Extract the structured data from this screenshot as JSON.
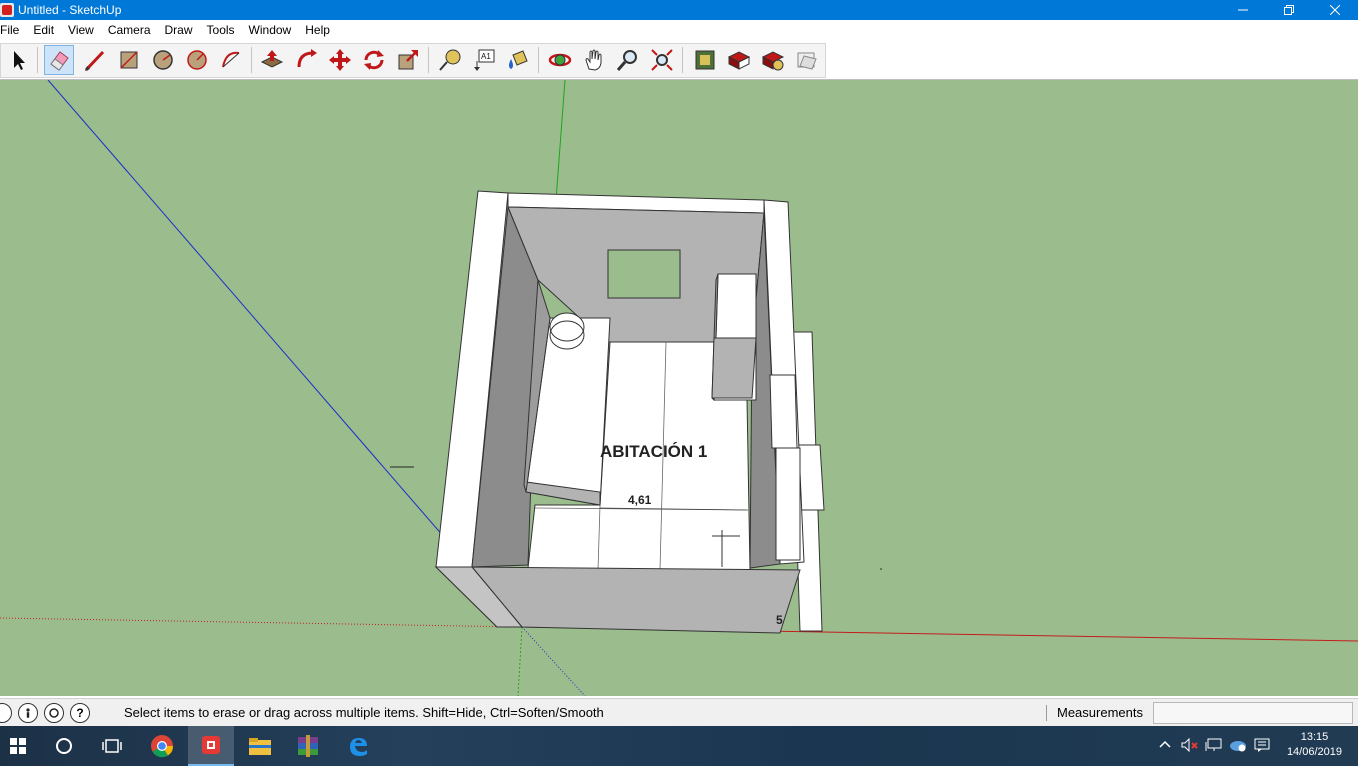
{
  "window": {
    "title": "Untitled - SketchUp",
    "controls": [
      "minimize-icon",
      "restore-icon",
      "close-icon"
    ]
  },
  "menu": [
    "File",
    "Edit",
    "View",
    "Camera",
    "Draw",
    "Tools",
    "Window",
    "Help"
  ],
  "toolbar": {
    "tools": [
      {
        "name": "select-tool",
        "icon": "arrow-cursor-icon"
      },
      {
        "name": "eraser-tool",
        "icon": "eraser-icon",
        "active": true
      },
      {
        "name": "line-tool",
        "icon": "pencil-icon"
      },
      {
        "name": "rectangle-tool",
        "icon": "rectangle-icon"
      },
      {
        "name": "circle-tool",
        "icon": "circle-icon"
      },
      {
        "name": "polygon-tool",
        "icon": "polygon-icon"
      },
      {
        "name": "arc-tool",
        "icon": "arc-icon"
      },
      {
        "name": "push-pull-tool",
        "icon": "push-pull-icon"
      },
      {
        "name": "follow-me-tool",
        "icon": "follow-me-icon"
      },
      {
        "name": "move-tool",
        "icon": "move-arrows-icon"
      },
      {
        "name": "rotate-tool",
        "icon": "rotate-icon"
      },
      {
        "name": "scale-tool",
        "icon": "scale-icon"
      },
      {
        "name": "tape-measure-tool",
        "icon": "tape-measure-icon"
      },
      {
        "name": "text-tool",
        "icon": "text-label-icon"
      },
      {
        "name": "paint-bucket-tool",
        "icon": "paint-bucket-icon"
      },
      {
        "name": "orbit-tool",
        "icon": "orbit-icon"
      },
      {
        "name": "pan-tool",
        "icon": "hand-icon"
      },
      {
        "name": "zoom-tool",
        "icon": "magnifier-icon"
      },
      {
        "name": "zoom-extents-tool",
        "icon": "zoom-extents-icon"
      },
      {
        "name": "3d-warehouse-tool",
        "icon": "warehouse-icon"
      },
      {
        "name": "extension-warehouse-tool",
        "icon": "extension-warehouse-icon"
      },
      {
        "name": "extension-manager-tool",
        "icon": "extension-manager-icon"
      },
      {
        "name": "layout-tool",
        "icon": "layout-icon"
      }
    ],
    "text_tool_label": "A1"
  },
  "viewport": {
    "colors": {
      "background": "#9bbd8e",
      "axis_green": "#1fa51f",
      "axis_blue": "#1b2ec4",
      "axis_red": "#c41b1b"
    },
    "labels": {
      "room_name": "ABITACIÓN 1",
      "dimension": "4,61",
      "edge_digit": "5"
    }
  },
  "status": {
    "text": "Select items to erase or drag across multiple items. Shift=Hide, Ctrl=Soften/Smooth",
    "icons": [
      "geo-location-icon",
      "credits-icon",
      "user-icon",
      "help-icon"
    ],
    "help_glyph": "?",
    "measurements_label": "Measurements",
    "measurements_value": ""
  },
  "taskbar": {
    "apps": [
      {
        "name": "windows-start",
        "icon": "windows-logo-icon"
      },
      {
        "name": "cortana",
        "icon": "search-circle-icon"
      },
      {
        "name": "task-view",
        "icon": "task-view-icon"
      },
      {
        "name": "chrome",
        "icon": "chrome-icon"
      },
      {
        "name": "sketchup",
        "icon": "sketchup-icon",
        "active": true
      },
      {
        "name": "file-explorer",
        "icon": "folder-icon"
      },
      {
        "name": "winrar",
        "icon": "winrar-icon"
      },
      {
        "name": "edge",
        "icon": "edge-icon"
      }
    ],
    "time": "13:15",
    "date": "14/06/2019"
  }
}
